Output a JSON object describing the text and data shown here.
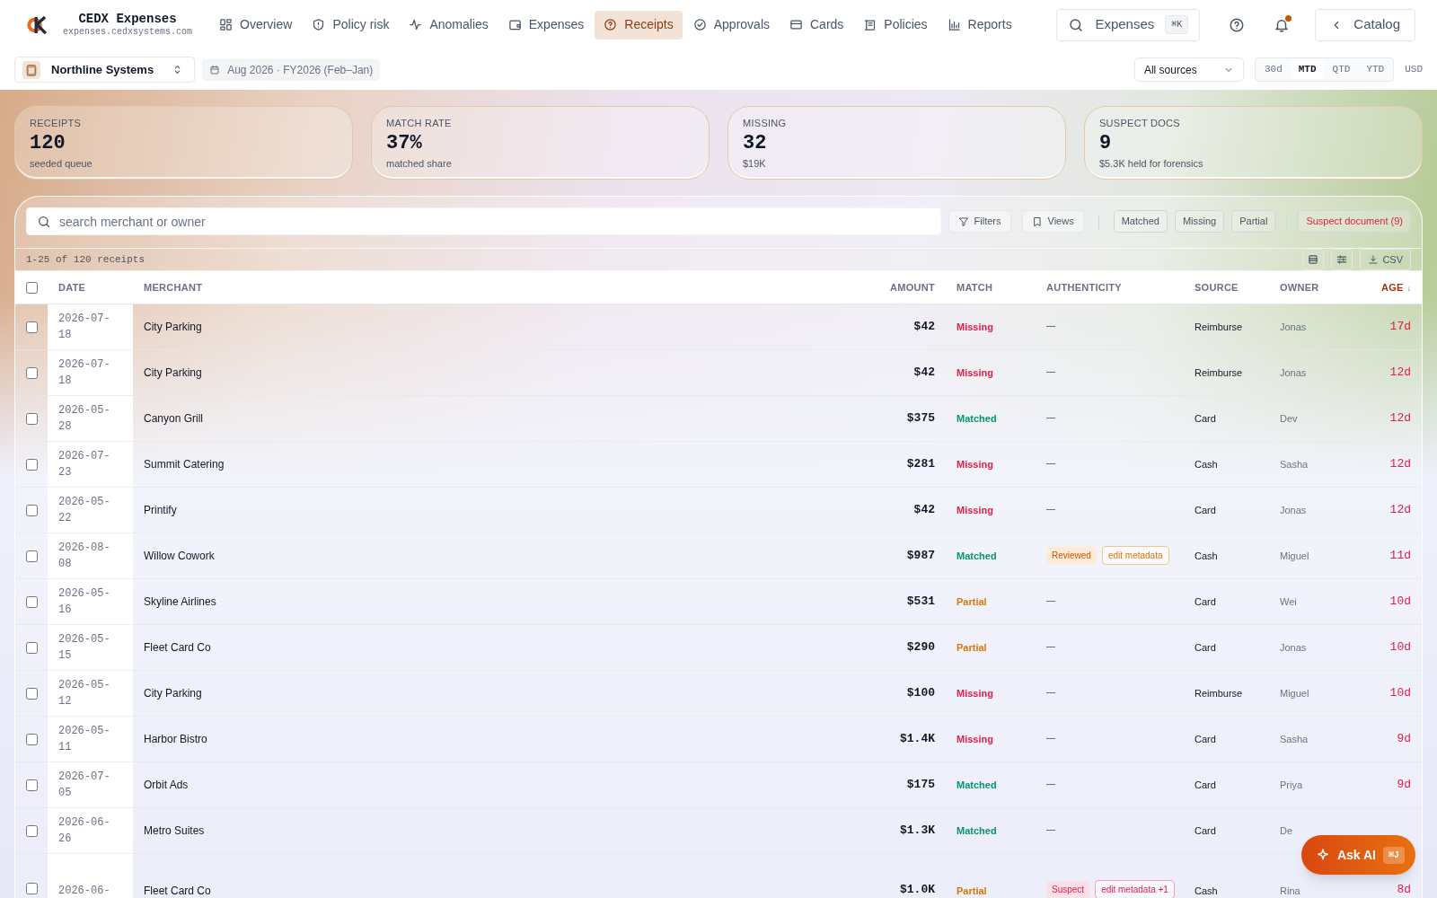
{
  "app": {
    "name": "CEDX Expenses",
    "domain": "expenses.cedxsystems.com"
  },
  "nav": [
    {
      "label": "Overview",
      "kind": "grid",
      "selected": false
    },
    {
      "label": "Policy risk",
      "kind": "shield",
      "selected": false
    },
    {
      "label": "Anomalies",
      "kind": "pulse",
      "selected": false
    },
    {
      "label": "Expenses",
      "kind": "wallet",
      "selected": false
    },
    {
      "label": "Receipts",
      "kind": "help",
      "selected": true
    },
    {
      "label": "Approvals",
      "kind": "check",
      "selected": false
    },
    {
      "label": "Cards",
      "kind": "card",
      "selected": false
    },
    {
      "label": "Policies",
      "kind": "scroll",
      "selected": false
    },
    {
      "label": "Reports",
      "kind": "bars",
      "selected": false
    }
  ],
  "search": {
    "label": "Expenses",
    "shortcut": "⌘K"
  },
  "notifications": {
    "unread": true
  },
  "catalog": "Catalog",
  "org": "Northline Systems",
  "period": "Aug 2026 · FY2026 (Feb–Jan)",
  "source_filter": "All sources",
  "ranges": [
    {
      "label": "30d",
      "selected": false
    },
    {
      "label": "MTD",
      "selected": true
    },
    {
      "label": "QTD",
      "selected": false
    },
    {
      "label": "YTD",
      "selected": false
    }
  ],
  "currency": "USD",
  "kpis": [
    {
      "label": "RECEIPTS",
      "value": "120",
      "note": "seeded queue"
    },
    {
      "label": "MATCH RATE",
      "value": "37%",
      "note": "matched share"
    },
    {
      "label": "MISSING",
      "value": "32",
      "note": "$19K"
    },
    {
      "label": "SUSPECT DOCS",
      "value": "9",
      "note": "$5.3K held for forensics"
    }
  ],
  "table_search": {
    "placeholder": "search merchant or owner"
  },
  "filters": "Filters",
  "views": "Views",
  "chips": [
    {
      "label": "Matched",
      "kind": "plain"
    },
    {
      "label": "Missing",
      "kind": "plain"
    },
    {
      "label": "Partial",
      "kind": "plain"
    },
    {
      "label": "Suspect document (9)",
      "kind": "alert"
    }
  ],
  "count": "1-25 of 120 receipts",
  "csv": "CSV",
  "all_selected": false,
  "columns": [
    "DATE",
    "MERCHANT",
    "AMOUNT",
    "MATCH",
    "AUTHENTICITY",
    "SOURCE",
    "OWNER",
    "AGE"
  ],
  "sort_mark": "↓",
  "rows": [
    {
      "date": "2026-07-18",
      "merchant": "City Parking",
      "amount": "$42",
      "match": "Missing",
      "auth": [],
      "source": "Reimburse",
      "owner": "Jonas",
      "age": "17d",
      "checked": false
    },
    {
      "date": "2026-07-18",
      "merchant": "City Parking",
      "amount": "$42",
      "match": "Missing",
      "auth": [],
      "source": "Reimburse",
      "owner": "Jonas",
      "age": "12d",
      "checked": false
    },
    {
      "date": "2026-05-28",
      "merchant": "Canyon Grill",
      "amount": "$375",
      "match": "Matched",
      "auth": [],
      "source": "Card",
      "owner": "Dev",
      "age": "12d",
      "checked": false
    },
    {
      "date": "2026-07-23",
      "merchant": "Summit Catering",
      "amount": "$281",
      "match": "Missing",
      "auth": [],
      "source": "Cash",
      "owner": "Sasha",
      "age": "12d",
      "checked": false
    },
    {
      "date": "2026-05-22",
      "merchant": "Printify",
      "amount": "$42",
      "match": "Missing",
      "auth": [],
      "source": "Card",
      "owner": "Jonas",
      "age": "12d",
      "checked": false
    },
    {
      "date": "2026-08-08",
      "merchant": "Willow Cowork",
      "amount": "$987",
      "match": "Matched",
      "auth": [
        {
          "label": "Reviewed",
          "kind": "reviewed"
        },
        {
          "label": "edit metadata",
          "kind": "reviewed-outline"
        }
      ],
      "source": "Cash",
      "owner": "Miguel",
      "age": "11d",
      "checked": false
    },
    {
      "date": "2026-05-16",
      "merchant": "Skyline Airlines",
      "amount": "$531",
      "match": "Partial",
      "auth": [],
      "source": "Card",
      "owner": "Wei",
      "age": "10d",
      "checked": false
    },
    {
      "date": "2026-05-15",
      "merchant": "Fleet Card Co",
      "amount": "$290",
      "match": "Partial",
      "auth": [],
      "source": "Card",
      "owner": "Jonas",
      "age": "10d",
      "checked": false
    },
    {
      "date": "2026-05-12",
      "merchant": "City Parking",
      "amount": "$100",
      "match": "Missing",
      "auth": [],
      "source": "Reimburse",
      "owner": "Miguel",
      "age": "10d",
      "checked": false
    },
    {
      "date": "2026-05-11",
      "merchant": "Harbor Bistro",
      "amount": "$1.4K",
      "match": "Missing",
      "auth": [],
      "source": "Card",
      "owner": "Sasha",
      "age": "9d",
      "checked": false
    },
    {
      "date": "2026-07-05",
      "merchant": "Orbit Ads",
      "amount": "$175",
      "match": "Matched",
      "auth": [],
      "source": "Card",
      "owner": "Priya",
      "age": "9d",
      "checked": false
    },
    {
      "date": "2026-06-26",
      "merchant": "Metro Suites",
      "amount": "$1.3K",
      "match": "Matched",
      "auth": [],
      "source": "Card",
      "owner": "De",
      "checked": false
    },
    {
      "date": "2026-06-",
      "merchant": "Fleet Card Co",
      "amount": "$1.0K",
      "match": "Partial",
      "auth": [
        {
          "label": "Suspect",
          "kind": "suspect"
        },
        {
          "label": "edit metadata +1",
          "kind": "suspect-outline"
        }
      ],
      "source": "Cash",
      "owner": "Rina",
      "age": "8d",
      "checked": false
    }
  ],
  "ask_ai": {
    "label": "Ask AI",
    "shortcut": "⌘J"
  }
}
